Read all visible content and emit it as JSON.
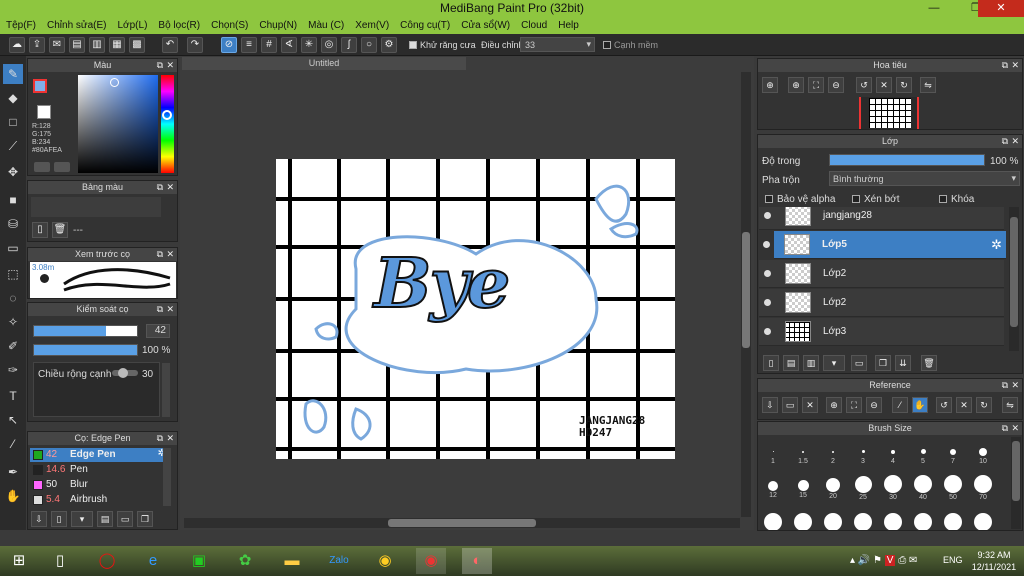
{
  "window": {
    "title": "MediBang Paint Pro (32bit)",
    "minimize": "—",
    "restore": "❐",
    "close": "✕"
  },
  "menu": [
    "Tệp(F)",
    "Chỉnh sửa(E)",
    "Lớp(L)",
    "Bộ lọc(R)",
    "Chọn(S)",
    "Chụp(N)",
    "Màu (C)",
    "Xem(V)",
    "Công cụ(T)",
    "Cửa sổ(W)",
    "Cloud",
    "Help"
  ],
  "toolbar": {
    "antialias_label": "Khử răng cưa",
    "correction_label": "Điều chỉnh",
    "correction_value": "33",
    "soft_edge_label": "Cạnh mềm"
  },
  "color_panel": {
    "title": "Màu",
    "r": "R:128",
    "g": "G:175",
    "b": "B:234",
    "hex": "#80AFEA",
    "primary_color": "#80afea"
  },
  "palette_panel": {
    "title": "Bảng màu",
    "dashes": "---"
  },
  "brush_preview": {
    "title": "Xem trước cọ",
    "size": "3.08m"
  },
  "brush_control": {
    "title": "Kiểm soát cọ",
    "size_value": "42",
    "opacity_value": "100 %",
    "width_label": "Chiều rộng cạnh",
    "width_value": "30"
  },
  "brush_list": {
    "title": "Cọ: Edge Pen",
    "items": [
      {
        "value": "42",
        "name": "Edge Pen",
        "color": "#1fa81f"
      },
      {
        "value": "14.6",
        "name": "Pen",
        "color": "#222222"
      },
      {
        "value": "50",
        "name": "Blur",
        "color": "#ff66ff"
      },
      {
        "value": "5.4",
        "name": "Airbrush",
        "color": "#dddddd"
      }
    ]
  },
  "document": {
    "tab": "Untitled",
    "art_text": "Bye",
    "signature_line1": "JANGJANG28",
    "signature_line2": "HD247"
  },
  "navigator": {
    "title": "Hoa tiêu"
  },
  "layers_panel": {
    "title": "Lớp",
    "opacity_label": "Độ trong",
    "opacity_value": "100 %",
    "blend_label": "Pha trộn",
    "blend_value": "Bình thường",
    "protect_alpha": "Bảo vệ alpha",
    "clipping": "Xén bớt",
    "lock": "Khóa",
    "layers": [
      {
        "name": "jangjang28",
        "selected": false
      },
      {
        "name": "Lớp5",
        "selected": true
      },
      {
        "name": "Lớp2",
        "selected": false
      },
      {
        "name": "Lớp2",
        "selected": false
      },
      {
        "name": "Lớp3",
        "selected": false
      }
    ]
  },
  "reference_panel": {
    "title": "Reference"
  },
  "brush_size_panel": {
    "title": "Brush Size",
    "sizes": [
      "1",
      "1.5",
      "2",
      "3",
      "4",
      "5",
      "7",
      "10",
      "12",
      "15",
      "20",
      "25",
      "30",
      "40",
      "50",
      "70"
    ]
  },
  "taskbar": {
    "lang": "ENG",
    "time": "9:32 AM",
    "date": "12/11/2021"
  }
}
